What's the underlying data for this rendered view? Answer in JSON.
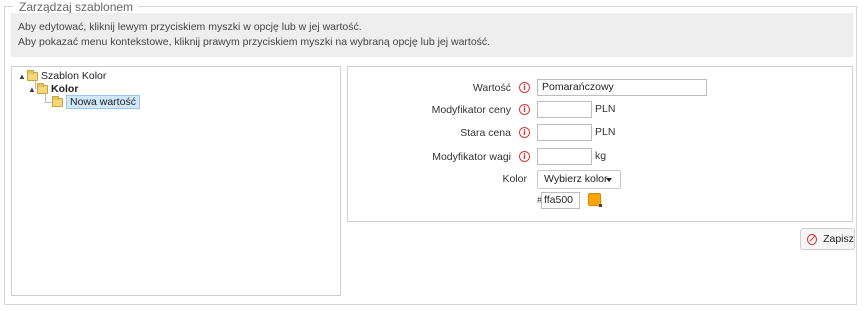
{
  "fieldset": {
    "legend": "Zarządzaj szablonem"
  },
  "info": {
    "line1": "Aby edytować, kliknij lewym przyciskiem myszki w opcję lub w jej wartość.",
    "line2": "Aby pokazać menu kontekstowe, kliknij prawym przyciskiem myszki na wybraną opcję lub jej wartość."
  },
  "tree": {
    "root": {
      "label": "Szablon Kolor",
      "toggle": "▲"
    },
    "child": {
      "label": "Kolor",
      "toggle": "▲"
    },
    "leaf": {
      "label": "Nowa wartość"
    }
  },
  "form": {
    "value": {
      "label": "Wartość",
      "value": "Pomarańczowy"
    },
    "price_modifier": {
      "label": "Modyfikator ceny",
      "value": "",
      "unit": "PLN"
    },
    "old_price": {
      "label": "Stara cena",
      "value": "",
      "unit": "PLN"
    },
    "weight_modifier": {
      "label": "Modyfikator wagi",
      "value": "",
      "unit": "kg"
    },
    "color": {
      "label": "Kolor",
      "select_value": "Wybierz kolor",
      "hash": "#",
      "hex_value": "ffa500",
      "swatch_color": "#ffa500"
    }
  },
  "actions": {
    "save_label": "Zapisz"
  },
  "colors": {
    "info_bg": "#eeeeee",
    "icon_red": "#d23c3c",
    "selected_bg": "#cfe8fb"
  }
}
